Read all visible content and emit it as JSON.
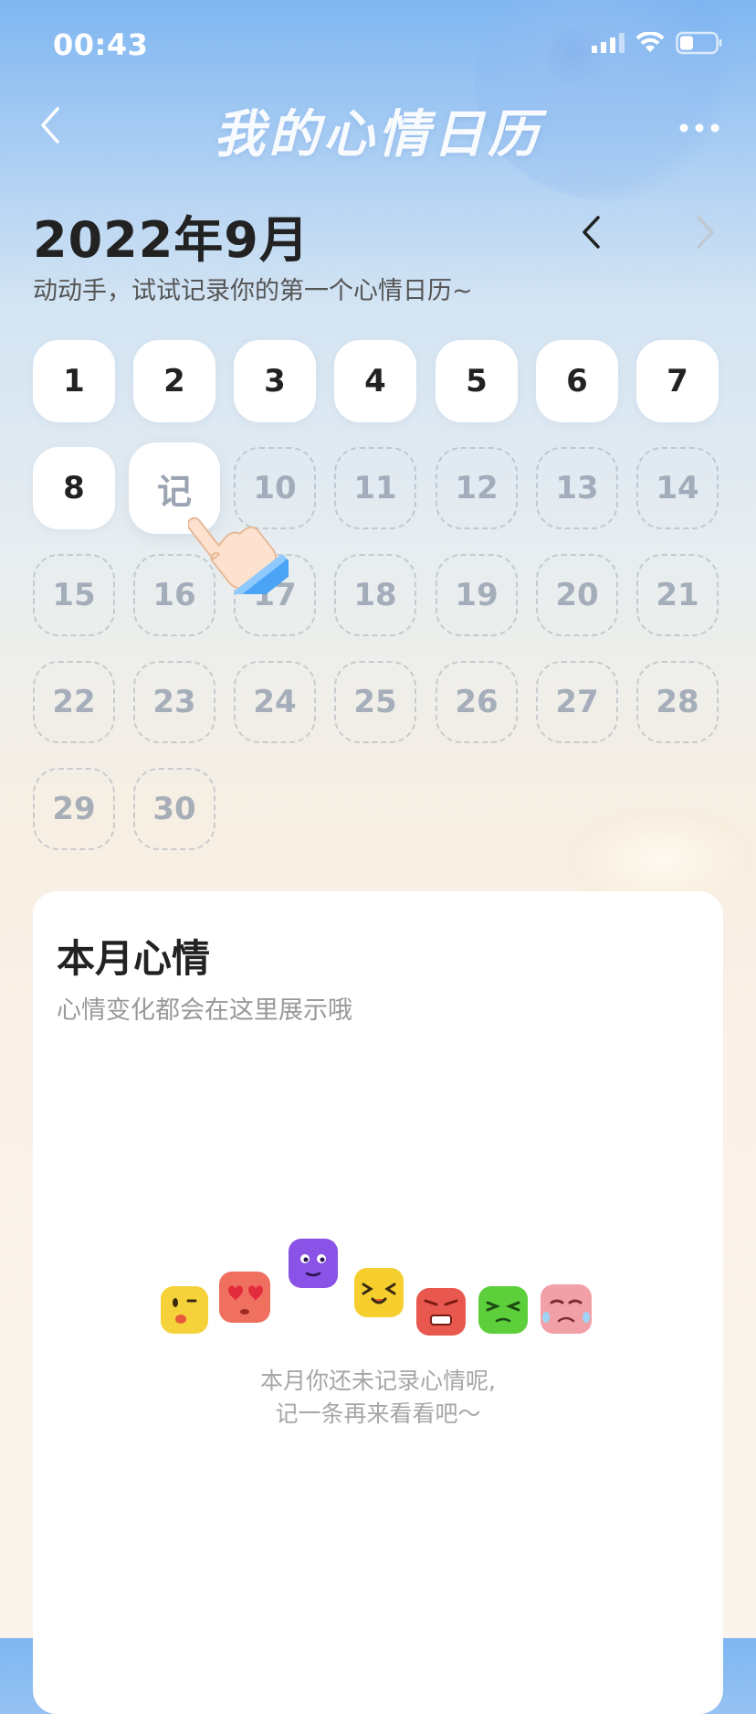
{
  "status_bar": {
    "time": "00:43"
  },
  "nav": {
    "title": "我的心情日历"
  },
  "header": {
    "month": "2022年9月",
    "subtitle": "动动手，试试记录你的第一个心情日历~"
  },
  "calendar": {
    "days_recorded": [
      "1",
      "2",
      "3",
      "4",
      "5",
      "6",
      "7",
      "8"
    ],
    "today_label": "记",
    "days_future": [
      "10",
      "11",
      "12",
      "13",
      "14",
      "15",
      "16",
      "17",
      "18",
      "19",
      "20",
      "21",
      "22",
      "23",
      "24",
      "25",
      "26",
      "27",
      "28",
      "29",
      "30"
    ]
  },
  "mood_card": {
    "title": "本月心情",
    "subtitle": "心情变化都会在这里展示哦",
    "empty_line1": "本月你还未记录心情呢,",
    "empty_line2": "记一条再来看看吧～"
  },
  "colors": {
    "accent_blue": "#7fb6f2",
    "text_dark": "#222222",
    "mascot_yellow": "#f6d23a",
    "mascot_red": "#f07060",
    "mascot_purple": "#8a52e6",
    "mascot_green": "#5ccf3a",
    "mascot_pink": "#f2a0a8"
  },
  "icons": {
    "back": "chevron-left-icon",
    "more": "more-dots-icon",
    "prev_month": "chevron-left-icon",
    "next_month": "chevron-right-icon",
    "pointer": "pointing-hand-icon"
  }
}
